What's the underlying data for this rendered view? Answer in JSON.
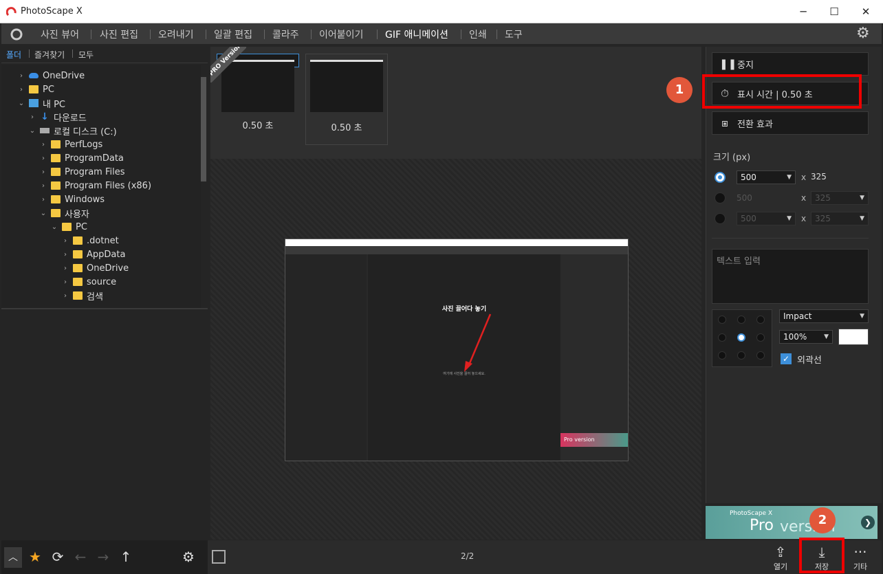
{
  "window": {
    "title": "PhotoScape X",
    "min": "─",
    "max": "☐",
    "close": "✕"
  },
  "menu": [
    "사진 뷰어",
    "사진 편집",
    "오려내기",
    "일괄 편집",
    "콜라주",
    "이어붙이기",
    "GIF 애니메이션",
    "인쇄",
    "도구"
  ],
  "left_tabs": [
    "폴더",
    "즐겨찾기",
    "모두"
  ],
  "tree": [
    {
      "label": "OneDrive",
      "icon": "cloud",
      "depth": 0,
      "chev": "›"
    },
    {
      "label": "PC",
      "icon": "folder",
      "depth": 0,
      "chev": "›"
    },
    {
      "label": "내 PC",
      "icon": "pc",
      "depth": 0,
      "chev": "⌄"
    },
    {
      "label": "다운로드",
      "icon": "down",
      "depth": 1,
      "chev": "›"
    },
    {
      "label": "로컬 디스크 (C:)",
      "icon": "drive",
      "depth": 1,
      "chev": "⌄"
    },
    {
      "label": "PerfLogs",
      "icon": "folder",
      "depth": 2,
      "chev": "›"
    },
    {
      "label": "ProgramData",
      "icon": "folder",
      "depth": 2,
      "chev": "›"
    },
    {
      "label": "Program Files",
      "icon": "folder",
      "depth": 2,
      "chev": "›"
    },
    {
      "label": "Program Files (x86)",
      "icon": "folder",
      "depth": 2,
      "chev": "›"
    },
    {
      "label": "Windows",
      "icon": "folder",
      "depth": 2,
      "chev": "›"
    },
    {
      "label": "사용자",
      "icon": "folder",
      "depth": 2,
      "chev": "⌄"
    },
    {
      "label": "PC",
      "icon": "folder",
      "depth": 3,
      "chev": "⌄"
    },
    {
      "label": ".dotnet",
      "icon": "folder",
      "depth": 4,
      "chev": "›"
    },
    {
      "label": "AppData",
      "icon": "folder",
      "depth": 4,
      "chev": "›"
    },
    {
      "label": "OneDrive",
      "icon": "folder",
      "depth": 4,
      "chev": "›"
    },
    {
      "label": "source",
      "icon": "folder",
      "depth": 4,
      "chev": "›"
    },
    {
      "label": "검색",
      "icon": "folder",
      "depth": 4,
      "chev": "›"
    }
  ],
  "thumbs": [
    {
      "label": "0.50 초"
    },
    {
      "label": "0.50 초"
    }
  ],
  "pro_badge": "PRO Version",
  "preview": {
    "title": "사진 끌어다 놓기",
    "sub": "여기에 사진을 끌어 놓으세요.",
    "ad": "Pro version"
  },
  "right": {
    "stop": "중지",
    "duration": "표시 시간 | 0.50 초",
    "transition": "전환 효과",
    "size_label": "크기 (px)",
    "size_rows": [
      {
        "w": "500",
        "h": "325",
        "enabled": true
      },
      {
        "w": "500",
        "h": "325",
        "enabled": false
      },
      {
        "w": "500",
        "h": "325",
        "enabled": false
      }
    ],
    "times": "x",
    "text_placeholder": "텍스트 입력",
    "font": "Impact",
    "scale": "100%",
    "outline": "외곽선"
  },
  "ad": {
    "t1": "PhotoScape X",
    "t2": "Pro",
    "t3": "version"
  },
  "bottom": {
    "page": "2/2",
    "open": "열기",
    "save": "저장",
    "more": "기타"
  },
  "badges": [
    "1",
    "2"
  ],
  "colors": {
    "accent": "#3d8fd9",
    "highlight": "#e00000",
    "badge": "#e2573a"
  }
}
